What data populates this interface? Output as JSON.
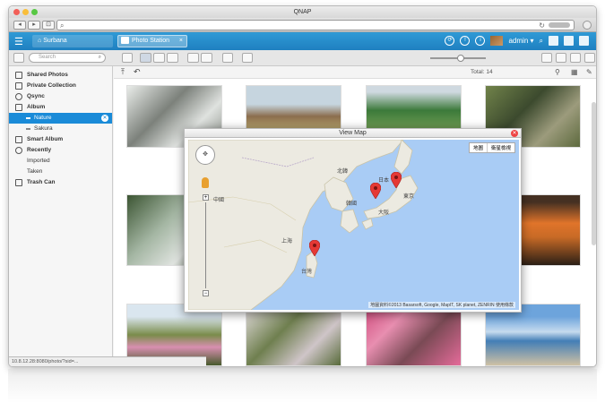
{
  "window": {
    "title": "QNAP"
  },
  "browser": {
    "url": ""
  },
  "app": {
    "home_tab": "Surbana",
    "photo_tab": "Photo Station",
    "close": "×",
    "user": "admin ▾"
  },
  "toolbar": {
    "search_placeholder": "Search"
  },
  "sidebar": {
    "items": [
      {
        "label": "Shared Photos"
      },
      {
        "label": "Private Collection"
      },
      {
        "label": "Qsync"
      },
      {
        "label": "Album"
      },
      {
        "label": "Nature"
      },
      {
        "label": "Sakura"
      },
      {
        "label": "Smart Album"
      },
      {
        "label": "Recently"
      },
      {
        "label": "Imported"
      },
      {
        "label": "Taken"
      },
      {
        "label": "Trash Can"
      }
    ]
  },
  "main": {
    "total": "Total: 14"
  },
  "map": {
    "title": "View Map",
    "map_button": "地圖",
    "satellite_button": "衛星檢視",
    "attribution": "地圖資料©2013 Basarsoft, Google, MapIT, SK planet, ZENRIN   使用條款",
    "labels": [
      "中國",
      "北韓",
      "日本",
      "韓國",
      "台灣",
      "上海",
      "東京",
      "大阪"
    ]
  },
  "status": {
    "text": "10.8.12.28:8080/photo/?sid=..."
  },
  "colors": {
    "accent": "#1f86c8",
    "selected": "#1a8bd8",
    "pin": "#e53935"
  }
}
